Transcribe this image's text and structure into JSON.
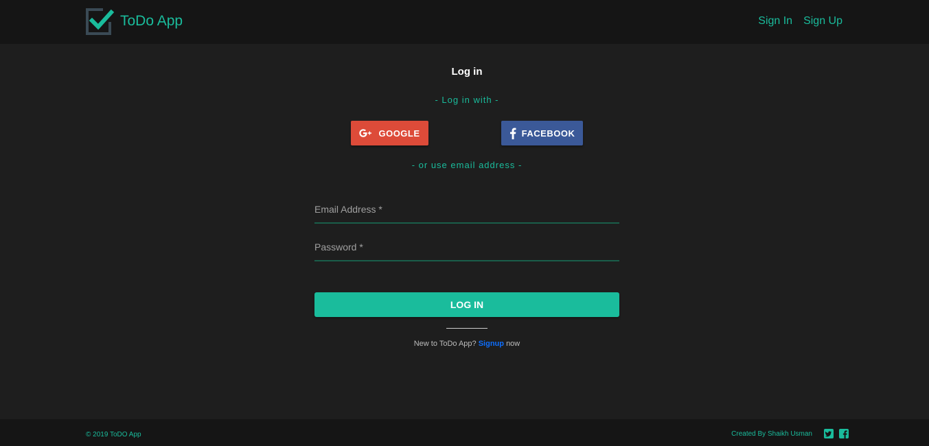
{
  "header": {
    "app_name": "ToDo App",
    "nav": {
      "sign_in": "Sign In",
      "sign_up": "Sign Up"
    }
  },
  "login": {
    "title": "Log in",
    "social_prompt": "- Log in with -",
    "google_label": "GOOGLE",
    "facebook_label": "FACEBOOK",
    "email_prompt": "- or use email address -",
    "email_placeholder": "Email Address *",
    "email_value": "",
    "password_placeholder": "Password *",
    "password_value": "",
    "submit_label": "LOG IN",
    "signup_prefix": "New to ToDo App?",
    "signup_link": "Signup",
    "signup_suffix": "now"
  },
  "footer": {
    "copyright": "© 2019 ToDO App",
    "credit": "Created By Shaikh Usman"
  },
  "icons": {
    "logo": "checkbox-check-icon",
    "google": "google-plus-icon",
    "facebook": "facebook-icon",
    "twitter": "twitter-square-icon",
    "facebook_square": "facebook-square-icon"
  },
  "colors": {
    "accent": "#1abc9c",
    "background": "#1e1e1e",
    "header_bg": "#151515",
    "google": "#dd4b39",
    "facebook": "#3b5998",
    "link": "#0d6efd"
  }
}
